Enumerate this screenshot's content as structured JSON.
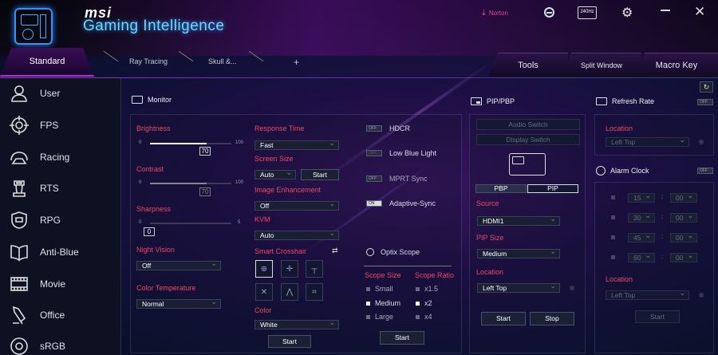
{
  "brand": {
    "logo_text": "msi",
    "title": "Gaming Intelligence"
  },
  "header": {
    "norton": "Norton",
    "resolution_badge": "240Hz"
  },
  "tabs": {
    "standard": "Standard",
    "ray_tracing": "Ray Tracing",
    "skull": "Skull &...",
    "add": "+",
    "tools": "Tools",
    "split_window": "Split Window",
    "macro_key": "Macro Key"
  },
  "sidebar": {
    "items": [
      {
        "label": "User",
        "icon": "user-icon"
      },
      {
        "label": "FPS",
        "icon": "crosshair-icon"
      },
      {
        "label": "Racing",
        "icon": "steering-wheel-icon"
      },
      {
        "label": "RTS",
        "icon": "chess-rook-icon"
      },
      {
        "label": "RPG",
        "icon": "shield-icon"
      },
      {
        "label": "Anti-Blue",
        "icon": "book-icon"
      },
      {
        "label": "Movie",
        "icon": "film-icon"
      },
      {
        "label": "Office",
        "icon": "pen-icon"
      },
      {
        "label": "sRGB",
        "icon": "color-circle-icon"
      }
    ]
  },
  "monitor": {
    "title": "Monitor",
    "brightness": {
      "label": "Brightness",
      "min": "0",
      "max": "100",
      "value": "70",
      "fraction": 0.7
    },
    "contrast": {
      "label": "Contrast",
      "min": "0",
      "max": "100",
      "value": "70",
      "fraction": 0.7
    },
    "sharpness": {
      "label": "Sharpness",
      "min": "0",
      "max": "5",
      "value": "0",
      "fraction": 0.0
    },
    "night_vision": {
      "label": "Night Vision",
      "value": "Off"
    },
    "color_temperature": {
      "label": "Color Temperature",
      "value": "Normal"
    },
    "response_time": {
      "label": "Response Time",
      "value": "Fast"
    },
    "screen_size": {
      "label": "Screen Size",
      "value": "Auto",
      "button": "Start"
    },
    "image_enhancement": {
      "label": "Image Enhancement",
      "value": "Off"
    },
    "kvm": {
      "label": "KVM",
      "value": "Auto"
    },
    "smart_crosshair": {
      "label": "Smart Crosshair"
    },
    "color": {
      "label": "Color",
      "value": "White"
    },
    "crosshair_start": "Start",
    "toggles": [
      {
        "label": "HDCR",
        "state": "OFF"
      },
      {
        "label": "Low Blue Light",
        "state": "OFF"
      },
      {
        "label": "MPRT Sync",
        "state": "OFF"
      },
      {
        "label": "Adaptive-Sync",
        "state": "ON"
      }
    ],
    "optix": {
      "title": "Optix Scope",
      "size_label": "Scope Size",
      "ratio_label": "Scope Ratio",
      "sizes": [
        "Small",
        "Medium",
        "Large"
      ],
      "ratios": [
        "x1.5",
        "x2",
        "x4"
      ],
      "selected_size": "Medium",
      "selected_ratio": "x2",
      "start": "Start"
    }
  },
  "pip": {
    "title": "PIP/PBP",
    "audio_switch": "Audio Switch",
    "display_switch": "Display Switch",
    "pbp": "PBP",
    "pip": "PIP",
    "source_label": "Source",
    "source_value": "HDMI1",
    "size_label": "PIP Size",
    "size_value": "Medium",
    "location_label": "Location",
    "location_value": "Left Top",
    "start": "Start",
    "stop": "Stop"
  },
  "refresh": {
    "title": "Refresh Rate",
    "toggle": "OFF",
    "location_label": "Location",
    "location_value": "Left Top"
  },
  "alarm": {
    "title": "Alarm Clock",
    "toggle": "OFF",
    "rows": [
      {
        "min": "15",
        "sec": "00"
      },
      {
        "min": "30",
        "sec": "00"
      },
      {
        "min": "45",
        "sec": "00"
      },
      {
        "min": "60",
        "sec": "00"
      }
    ],
    "location_label": "Location",
    "location_value": "Left Top",
    "start": "Start"
  }
}
